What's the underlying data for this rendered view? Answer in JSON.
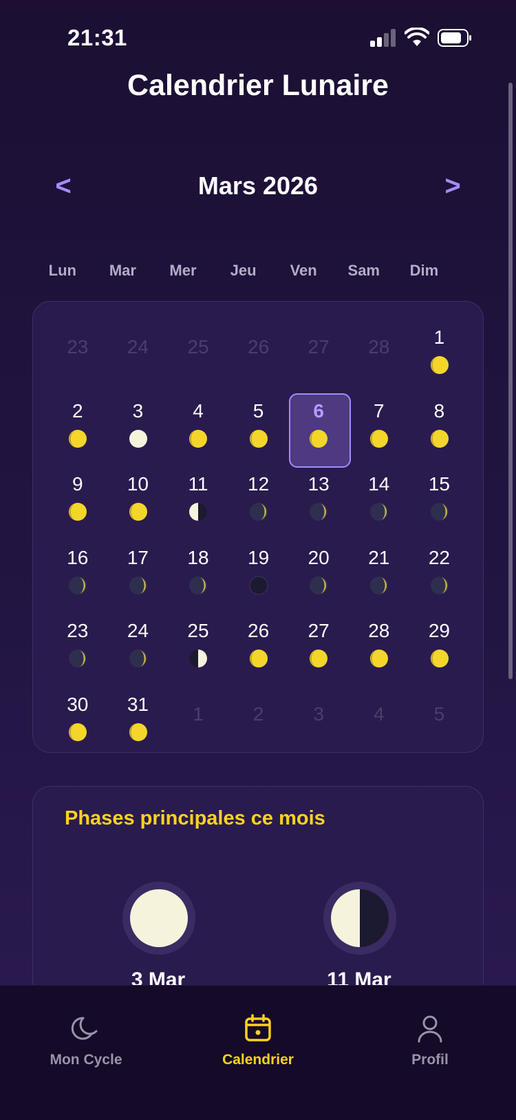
{
  "status": {
    "time": "21:31"
  },
  "header": {
    "title": "Calendrier Lunaire"
  },
  "month_nav": {
    "prev": "<",
    "label": "Mars 2026",
    "next": ">"
  },
  "weekdays": [
    "Lun",
    "Mar",
    "Mer",
    "Jeu",
    "Ven",
    "Sam",
    "Dim"
  ],
  "calendar": {
    "selected_day": 6,
    "cells": [
      {
        "day": "23",
        "muted": true
      },
      {
        "day": "24",
        "muted": true
      },
      {
        "day": "25",
        "muted": true
      },
      {
        "day": "26",
        "muted": true
      },
      {
        "day": "27",
        "muted": true
      },
      {
        "day": "28",
        "muted": true
      },
      {
        "day": "1",
        "phase": "waxing-gibbous"
      },
      {
        "day": "2",
        "phase": "waxing-gibbous"
      },
      {
        "day": "3",
        "phase": "full-moon"
      },
      {
        "day": "4",
        "phase": "waning-gibbous"
      },
      {
        "day": "5",
        "phase": "waning-gibbous"
      },
      {
        "day": "6",
        "phase": "waning-gibbous"
      },
      {
        "day": "7",
        "phase": "waning-gibbous"
      },
      {
        "day": "8",
        "phase": "waning-gibbous"
      },
      {
        "day": "9",
        "phase": "waning-gibbous"
      },
      {
        "day": "10",
        "phase": "waning-gibbous"
      },
      {
        "day": "11",
        "phase": "last-quarter"
      },
      {
        "day": "12",
        "phase": "waning-crescent"
      },
      {
        "day": "13",
        "phase": "waning-crescent"
      },
      {
        "day": "14",
        "phase": "waning-crescent"
      },
      {
        "day": "15",
        "phase": "waning-crescent"
      },
      {
        "day": "16",
        "phase": "waning-crescent"
      },
      {
        "day": "17",
        "phase": "waning-crescent"
      },
      {
        "day": "18",
        "phase": "waning-crescent"
      },
      {
        "day": "19",
        "phase": "new-moon"
      },
      {
        "day": "20",
        "phase": "waxing-crescent"
      },
      {
        "day": "21",
        "phase": "waxing-crescent"
      },
      {
        "day": "22",
        "phase": "waxing-crescent"
      },
      {
        "day": "23",
        "phase": "waxing-crescent"
      },
      {
        "day": "24",
        "phase": "waxing-crescent"
      },
      {
        "day": "25",
        "phase": "first-quarter"
      },
      {
        "day": "26",
        "phase": "waxing-gibbous"
      },
      {
        "day": "27",
        "phase": "waxing-gibbous"
      },
      {
        "day": "28",
        "phase": "waxing-gibbous"
      },
      {
        "day": "29",
        "phase": "waxing-gibbous"
      },
      {
        "day": "30",
        "phase": "waxing-gibbous"
      },
      {
        "day": "31",
        "phase": "waxing-gibbous"
      },
      {
        "day": "1",
        "muted": true
      },
      {
        "day": "2",
        "muted": true
      },
      {
        "day": "3",
        "muted": true
      },
      {
        "day": "4",
        "muted": true
      },
      {
        "day": "5",
        "muted": true
      }
    ]
  },
  "phases": {
    "title": "Phases principales ce mois",
    "items": [
      {
        "date": "3 Mar",
        "phase": "full-moon"
      },
      {
        "date": "11 Mar",
        "phase": "last-quarter"
      }
    ]
  },
  "tabs": [
    {
      "label": "Mon Cycle",
      "icon": "moon-icon",
      "active": false
    },
    {
      "label": "Calendrier",
      "icon": "calendar-icon",
      "active": true
    },
    {
      "label": "Profil",
      "icon": "profile-icon",
      "active": false
    }
  ],
  "colors": {
    "accent_purple": "#a68bff",
    "accent_yellow": "#ffd21f",
    "moon_light": "#f5f3dc",
    "moon_dark": "#1c1a30"
  }
}
